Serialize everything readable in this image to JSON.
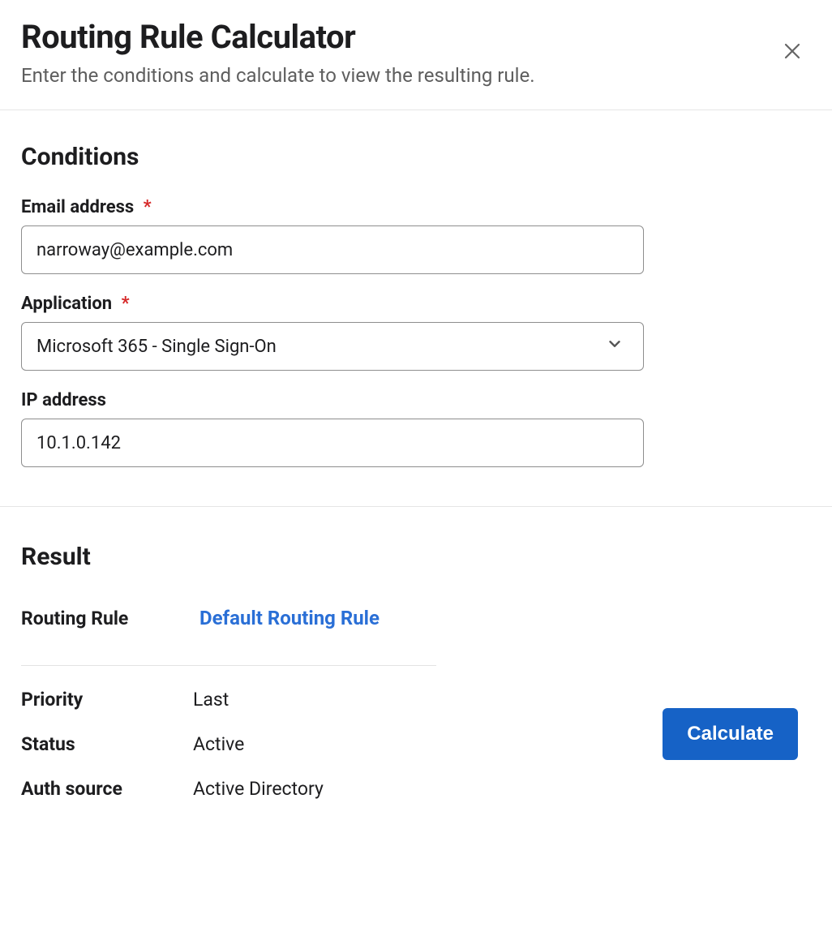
{
  "header": {
    "title": "Routing Rule Calculator",
    "subtitle": "Enter the conditions and calculate to view the resulting rule."
  },
  "conditions": {
    "heading": "Conditions",
    "email": {
      "label": "Email address",
      "required": "*",
      "value": "narroway@example.com"
    },
    "application": {
      "label": "Application",
      "required": "*",
      "value": "Microsoft 365 - Single Sign-On"
    },
    "ip": {
      "label": "IP address",
      "value": "10.1.0.142"
    }
  },
  "result": {
    "heading": "Result",
    "routing_rule": {
      "label": "Routing Rule",
      "value": "Default Routing Rule"
    },
    "priority": {
      "label": "Priority",
      "value": "Last"
    },
    "status": {
      "label": "Status",
      "value": "Active"
    },
    "auth_source": {
      "label": "Auth source",
      "value": "Active Directory"
    }
  },
  "actions": {
    "calculate": "Calculate"
  }
}
